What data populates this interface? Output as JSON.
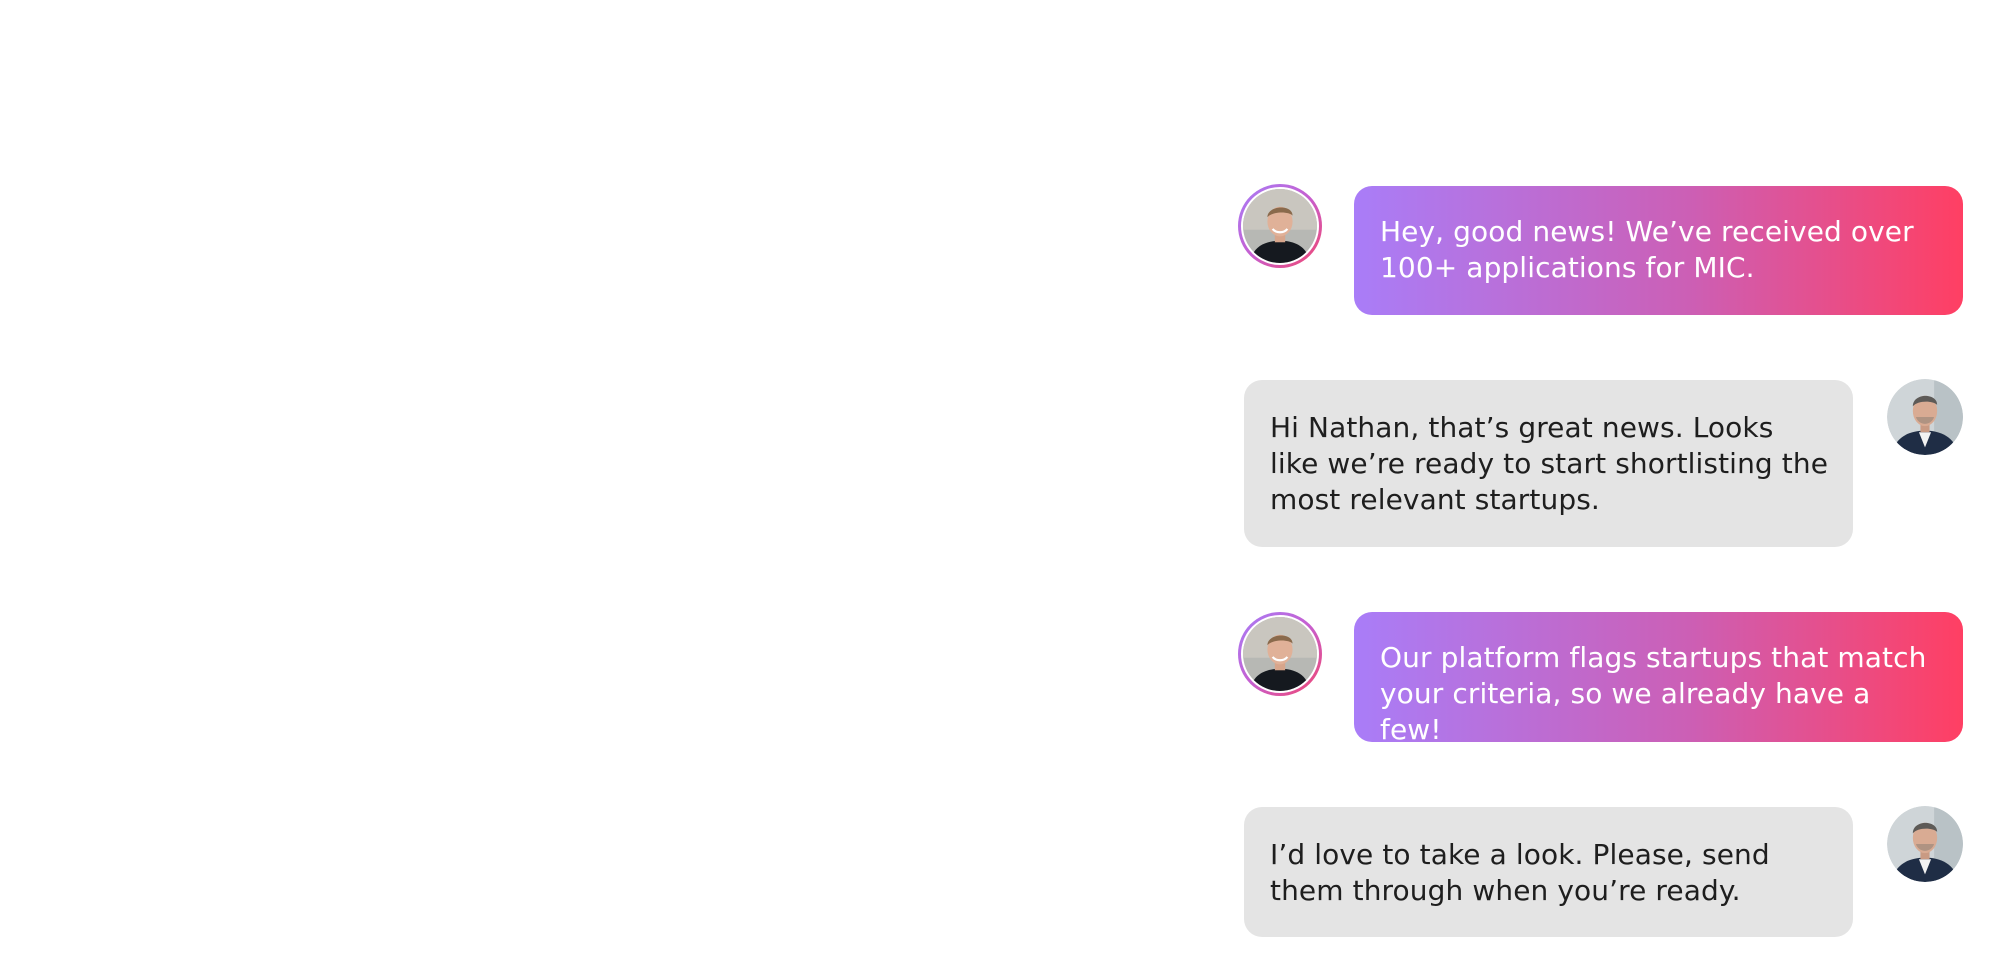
{
  "conversation": {
    "messages": [
      {
        "sender": "nathan",
        "avatar_icon": "nathan-avatar-icon",
        "text": "Hey, good news! We’ve received over 100+ applications for MIC."
      },
      {
        "sender": "contact",
        "avatar_icon": "contact-avatar-icon",
        "text": "Hi Nathan, that’s great news. Looks like we’re ready to start shortlisting the most relevant startups."
      },
      {
        "sender": "nathan",
        "avatar_icon": "nathan-avatar-icon",
        "text": "Our platform flags startups that match your criteria, so we already have a few!"
      },
      {
        "sender": "contact",
        "avatar_icon": "contact-avatar-icon",
        "text": "I’d love to take a look. Please, send them through when you’re ready."
      }
    ]
  },
  "colors": {
    "sent_gradient_start": "#a97df8",
    "sent_gradient_mid": "#cc5fb5",
    "sent_gradient_end": "#ff3f63",
    "received_bubble": "#e4e4e4",
    "received_text": "#1e1e1e",
    "sent_text": "#ffffff"
  }
}
